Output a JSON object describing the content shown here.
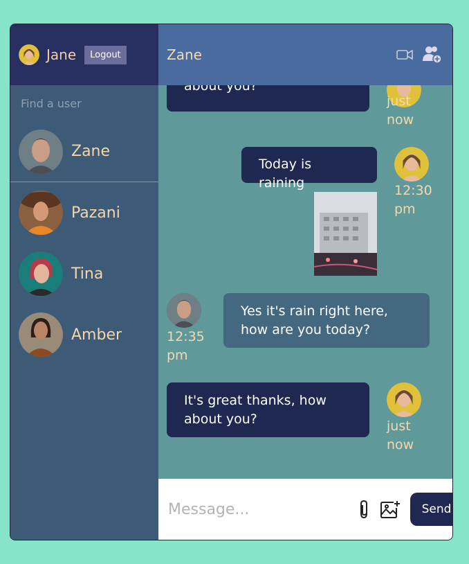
{
  "current_user": {
    "name": "Jane",
    "logout_label": "Logout"
  },
  "search": {
    "placeholder": "Find a user"
  },
  "users": [
    {
      "name": "Zane",
      "active": true
    },
    {
      "name": "Pazani",
      "active": false
    },
    {
      "name": "Tina",
      "active": false
    },
    {
      "name": "Amber",
      "active": false
    }
  ],
  "chat": {
    "title": "Zane",
    "icons": [
      "video-camera-icon",
      "add-user-icon",
      "menu-icon"
    ],
    "messages": [
      {
        "from": "me",
        "text": "about you?",
        "time": "just now"
      },
      {
        "from": "me",
        "text": "Today is raining",
        "time": "12:30 pm"
      },
      {
        "from": "them",
        "text": "Yes it's rain right here, how are you today?",
        "time": "12:35 pm"
      },
      {
        "from": "me",
        "text": "It's great thanks, how about you?",
        "time": "just now"
      }
    ]
  },
  "composer": {
    "placeholder": "Message...",
    "send_label": "Send",
    "icons": [
      "paperclip-icon",
      "add-image-icon"
    ]
  },
  "colors": {
    "background": "#86e4c8",
    "sidebar": "#3d5a76",
    "sidebar_header": "#262f60",
    "chat_header": "#496b9d",
    "chat_area": "#5f9999",
    "my_bubble": "#1f2850",
    "their_bubble": "#44687f",
    "accent_text": "#f4d6a8"
  }
}
